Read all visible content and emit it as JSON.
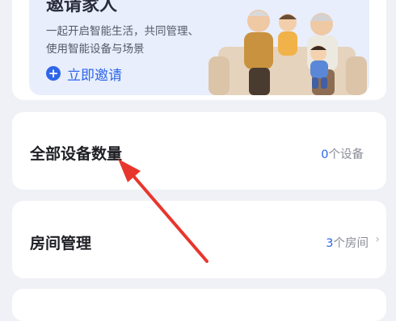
{
  "invite_banner": {
    "title_partial": "邀请家人",
    "desc_line_1": "一起开启智能生活，共同管理、",
    "desc_line_2": "使用智能设备与场景",
    "invite_label": "立即邀请"
  },
  "device_count_row": {
    "title": "全部设备数量",
    "count": "0",
    "unit": "个设备"
  },
  "room_row": {
    "title": "房间管理",
    "count": "3",
    "unit": "个房间",
    "chevron": "›"
  },
  "colors": {
    "accent": "#2e66e8",
    "banner_bg": "#e8eefc",
    "page_bg": "#f0f1f6",
    "annotation_arrow": "#e8362d"
  },
  "icons": {
    "invite": "plus-circle-icon",
    "room": "chevron-right-icon"
  }
}
